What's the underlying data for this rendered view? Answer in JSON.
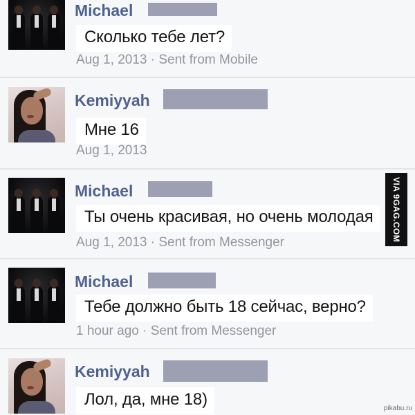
{
  "messages": [
    {
      "sender": "Michael",
      "text": "Сколько тебе лет?",
      "meta": "Aug 1, 2013 · Sent from Mobile"
    },
    {
      "sender": "Kemiyyah",
      "text": "Мне 16",
      "meta": "Aug 1, 2013"
    },
    {
      "sender": "Michael",
      "text": "Ты очень красивая, но очень молодая",
      "meta": "Aug 1, 2013 · Sent from Messenger"
    },
    {
      "sender": "Michael",
      "text": "Тебе должно быть 18 сейчас, верно?",
      "meta": "1 hour ago · Sent from Messenger"
    },
    {
      "sender": "Kemiyyah",
      "text": "Лол, да, мне 18)",
      "meta": ""
    }
  ],
  "watermark": "VIA 9GAG.COM",
  "source_mark": "pikabu.ru",
  "colors": {
    "sender_name": "#4f6290",
    "meta_text": "#92959c",
    "redaction": "#9da0b3",
    "background": "#f4f5f7"
  }
}
